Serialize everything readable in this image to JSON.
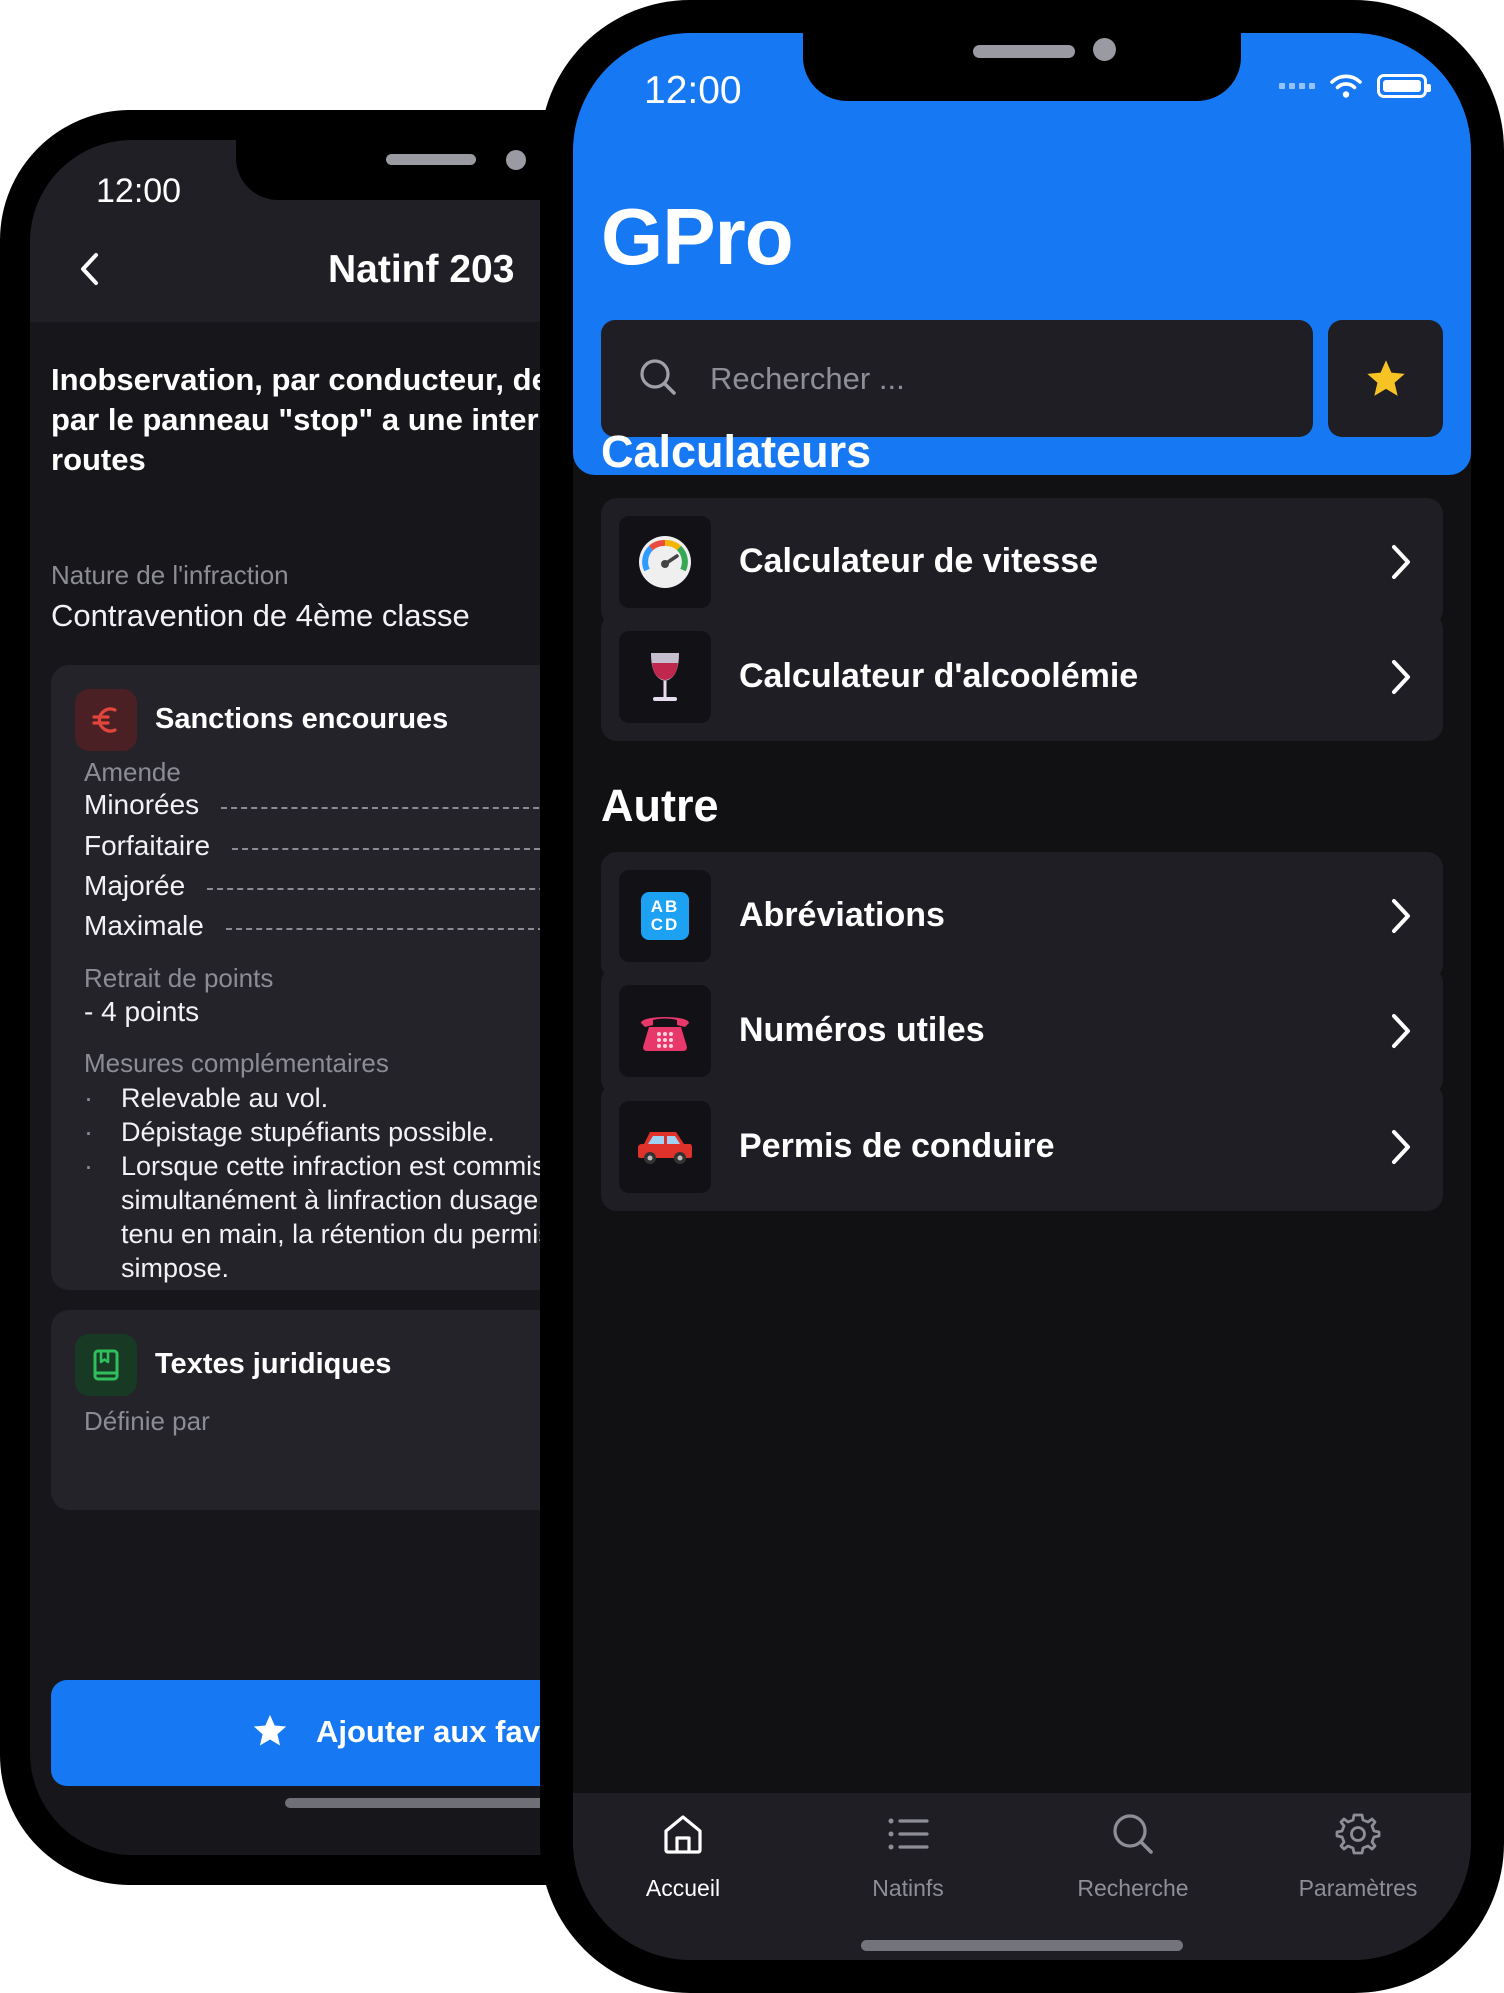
{
  "back_phone": {
    "status_time": "12:00",
    "nav_title": "Natinf 203",
    "headline": "Inobservation, par conducteur, de l'arrêt imposé\npar le panneau \"stop\" a une intersection de\nroutes",
    "nature_label": "Nature de l'infraction",
    "nature_value": "Contravention de 4ème classe",
    "sanctions": {
      "title": "Sanctions encourues",
      "amende_label": "Amende",
      "fines": [
        {
          "label": "Minorées"
        },
        {
          "label": "Forfaitaire"
        },
        {
          "label": "Majorée"
        },
        {
          "label": "Maximale"
        }
      ],
      "points_label": "Retrait de points",
      "points_value": "- 4 points",
      "mesures_label": "Mesures complémentaires",
      "mesures": [
        "Relevable au vol.",
        "Dépistage stupéfiants possible.",
        "Lorsque cette infraction est commise\nsimultanément à linfraction dusage du téléphone\ntenu en main, la rétention du permis de conduire\nsimpose."
      ],
      "bullet_char": "·"
    },
    "textes": {
      "title": "Textes juridiques",
      "definie_label": "Définie par"
    },
    "favorite_button": "Ajouter aux favoris"
  },
  "front_phone": {
    "status_time": "12:00",
    "app_title": "GPro",
    "search": {
      "placeholder": "Rechercher ..."
    },
    "sections": [
      {
        "title": "Calculateurs",
        "items": [
          {
            "label": "Calculateur de vitesse",
            "icon": "speedometer-icon"
          },
          {
            "label": "Calculateur d'alcoolémie",
            "icon": "wine-glass-icon"
          }
        ]
      },
      {
        "title": "Autre",
        "items": [
          {
            "label": "Abréviations",
            "icon": "abcd-icon",
            "icon_text": "AB\nCD"
          },
          {
            "label": "Numéros utiles",
            "icon": "telephone-icon"
          },
          {
            "label": "Permis de conduire",
            "icon": "car-icon"
          }
        ]
      }
    ],
    "tabs": [
      {
        "label": "Accueil",
        "icon": "home-icon",
        "active": true
      },
      {
        "label": "Natinfs",
        "icon": "list-icon",
        "active": false
      },
      {
        "label": "Recherche",
        "icon": "search-icon",
        "active": false
      },
      {
        "label": "Paramètres",
        "icon": "gear-icon",
        "active": false
      }
    ]
  },
  "colors": {
    "accent": "#1778f3",
    "star": "#f7c324",
    "euro_red": "#e2453c",
    "book_green": "#2fbf5b"
  }
}
